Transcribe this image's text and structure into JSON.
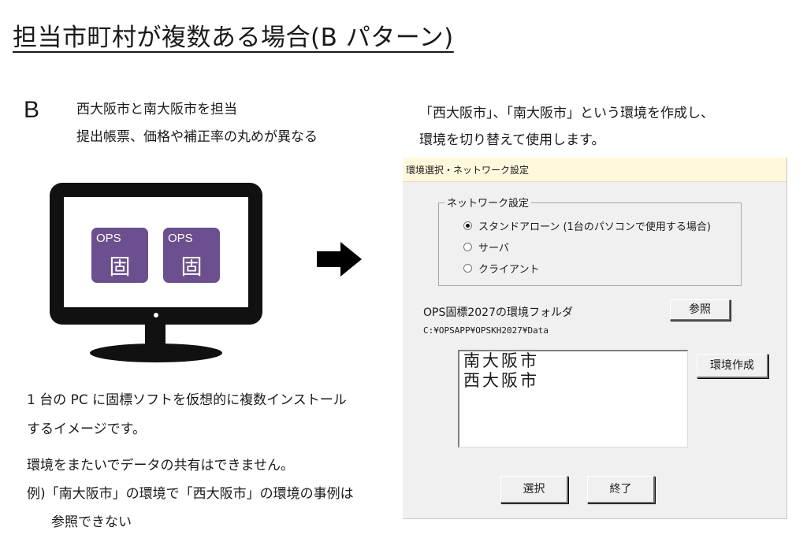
{
  "title": "担当市町村が複数ある場合(B パターン)",
  "case": {
    "letter": "B",
    "line1": "西大阪市と南大阪市を担当",
    "line2": "提出帳票、価格や補正率の丸めが異なる"
  },
  "right_text": {
    "line1": "「西大阪市」、「南大阪市」という環境を作成し、",
    "line2": "環境を切り替えて使用します。"
  },
  "monitor": {
    "tiles": [
      {
        "label": "OPS",
        "kanji": "固"
      },
      {
        "label": "OPS",
        "kanji": "固"
      }
    ]
  },
  "notes": {
    "line1": "1 台の PC に固標ソフトを仮想的に複数インストール",
    "line2": "するイメージです。",
    "line3": "環境をまたいでデータの共有はできません。",
    "line4": "例)「南大阪市」の環境で「西大阪市」の環境の事例は",
    "line5": "参照できない"
  },
  "dialog": {
    "window_title": "環境選択・ネットワーク設定",
    "group_label": "ネットワーク設定",
    "radios": [
      {
        "label": "スタンドアローン (1台のパソコンで使用する場合)",
        "selected": true
      },
      {
        "label": "サーバ",
        "selected": false
      },
      {
        "label": "クライアント",
        "selected": false
      }
    ],
    "folder_label": "OPS固標2027の環境フォルダ",
    "browse_label": "参照",
    "folder_path": "C:¥OPSAPP¥OPSKH2027¥Data",
    "environments": [
      "南大阪市",
      "西大阪市"
    ],
    "create_label": "環境作成",
    "select_label": "選択",
    "exit_label": "終了"
  }
}
